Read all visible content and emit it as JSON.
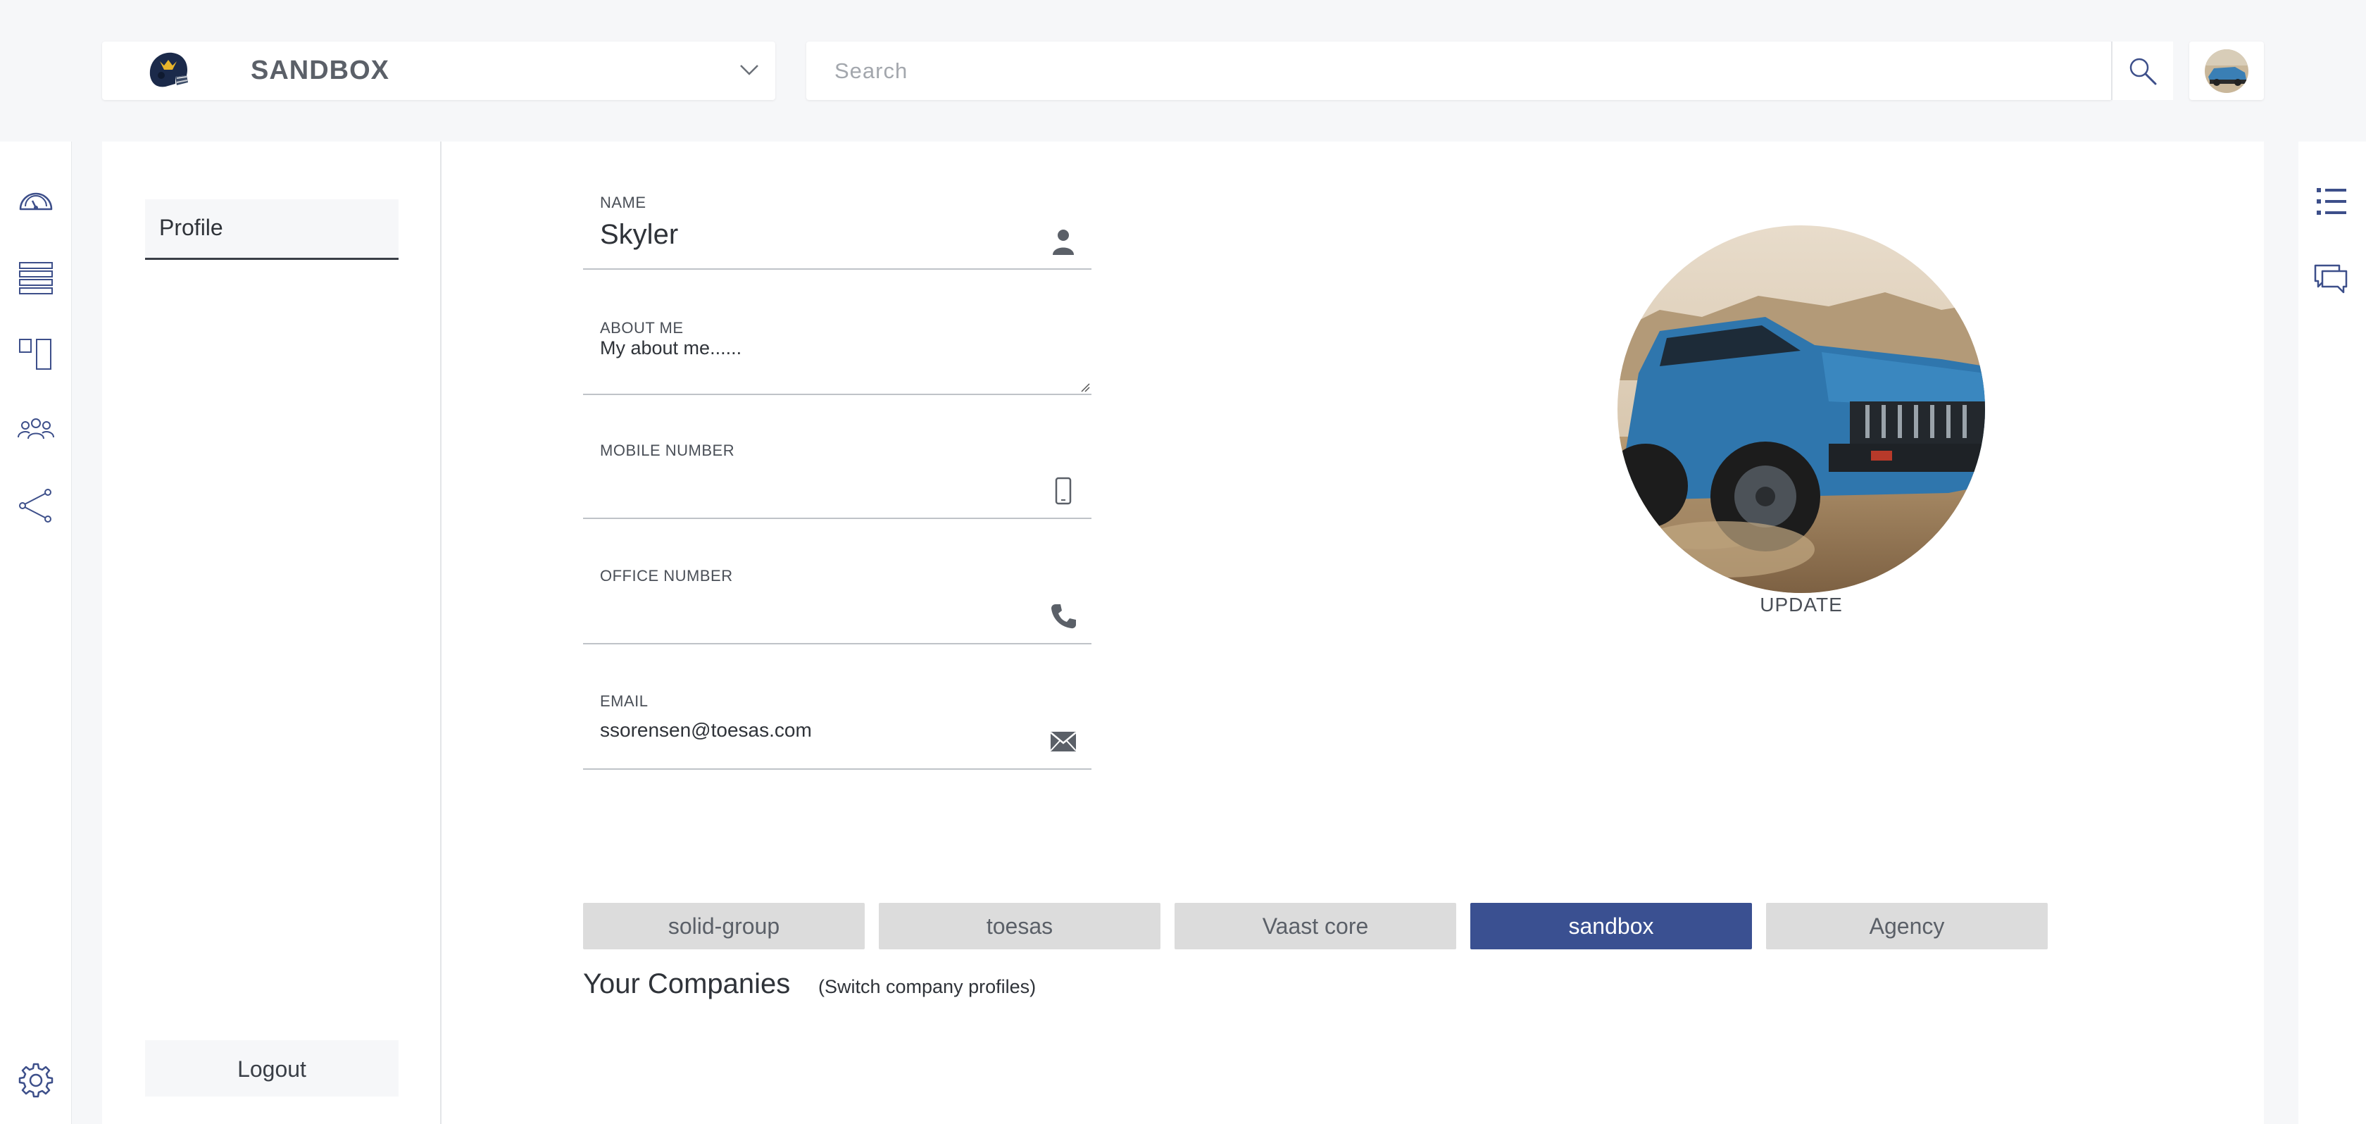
{
  "header": {
    "company_name": "SANDBOX",
    "search_placeholder": "Search"
  },
  "sidebar": {
    "profile_tab": "Profile",
    "logout_label": "Logout"
  },
  "form": {
    "name": {
      "label": "NAME",
      "value": "Skyler"
    },
    "about": {
      "label": "ABOUT ME",
      "value": "My about me......"
    },
    "mobile": {
      "label": "MOBILE NUMBER",
      "value": ""
    },
    "office": {
      "label": "OFFICE NUMBER",
      "value": ""
    },
    "email": {
      "label": "EMAIL",
      "value": "ssorensen@toesas.com"
    }
  },
  "companies": {
    "title": "Your Companies",
    "subtitle": "(Switch company profiles)",
    "items": [
      {
        "label": "solid-group",
        "active": false
      },
      {
        "label": "toesas",
        "active": false
      },
      {
        "label": "Vaast core",
        "active": false
      },
      {
        "label": "sandbox",
        "active": true
      },
      {
        "label": "Agency",
        "active": false
      }
    ]
  },
  "photo": {
    "update_label": "UPDATE"
  },
  "colors": {
    "accent": "#3a5091",
    "icon_blue": "#3d4f8a",
    "chip_bg": "#dcdcdc"
  },
  "icons": {
    "left_rail": [
      "dashboard-gauge-icon",
      "list-icon",
      "layout-columns-icon",
      "team-icon",
      "share-icon",
      "gear-icon"
    ],
    "right_rail": [
      "list-bullets-icon",
      "chat-bubbles-icon"
    ]
  }
}
